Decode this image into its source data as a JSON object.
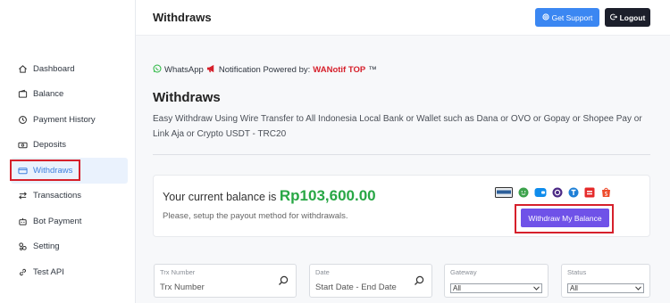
{
  "sidebar": {
    "items": [
      {
        "label": "Dashboard",
        "icon": "home-icon"
      },
      {
        "label": "Balance",
        "icon": "wallet-icon"
      },
      {
        "label": "Payment History",
        "icon": "history-icon"
      },
      {
        "label": "Deposits",
        "icon": "deposit-icon"
      },
      {
        "label": "Withdraws",
        "icon": "withdraw-icon",
        "active": true
      },
      {
        "label": "Transactions",
        "icon": "transfer-arrows-icon"
      },
      {
        "label": "Bot Payment",
        "icon": "bot-icon"
      },
      {
        "label": "Setting",
        "icon": "settings-icon"
      },
      {
        "label": "Test API",
        "icon": "link-icon"
      }
    ]
  },
  "header": {
    "title": "Withdraws",
    "support_label": "Get Support",
    "logout_label": "Logout"
  },
  "notice": {
    "whatsapp": "WhatsApp",
    "text": "Notification Powered by:",
    "brand": "WANotif TOP",
    "tm": "™"
  },
  "page": {
    "title": "Withdraws",
    "description": "Easy Withdraw Using Wire Transfer to All Indonesia Local Bank or Wallet such as Dana or OVO or Gopay or Shopee Pay or Link Aja or Crypto USDT - TRC20"
  },
  "balance": {
    "label": "Your current balance is",
    "amount": "Rp103,600.00",
    "subtext": "Please, setup the payout method for withdrawals.",
    "withdraw_label": "Withdraw My Balance",
    "payment_icons": [
      "bank-card-icon",
      "gopay-icon",
      "dana-icon",
      "ovo-icon",
      "tether-icon",
      "linkaja-icon",
      "shopeepay-icon"
    ]
  },
  "filters": {
    "trx_label": "Trx Number",
    "trx_placeholder": "Trx Number",
    "date_label": "Date",
    "date_placeholder": "Start Date - End Date",
    "gateway_label": "Gateway",
    "gateway_value": "All",
    "status_label": "Status",
    "status_value": "All"
  },
  "colors": {
    "accent": "#3e7fde",
    "highlight": "#d6202b",
    "balance_green": "#28a745",
    "withdraw_purple": "#6f52e8",
    "support_blue": "#3b87f2",
    "logout_dark": "#1c1f2b"
  }
}
